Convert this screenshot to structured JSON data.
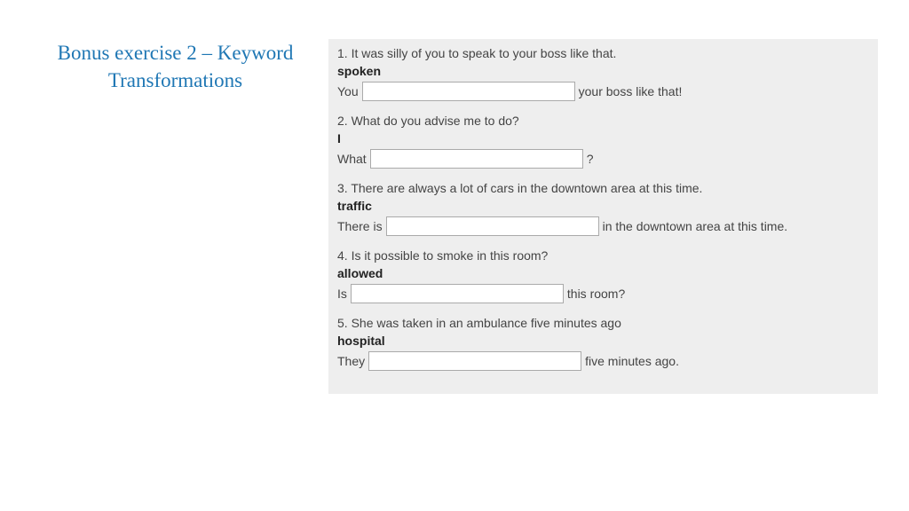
{
  "title": "Bonus exercise 2 – Keyword Transformations",
  "questions": [
    {
      "number": "1.",
      "prompt": "It was silly of you to speak to your boss like that.",
      "keyword": "spoken",
      "pre": "You",
      "post": "your boss like that!"
    },
    {
      "number": "2.",
      "prompt": "What do you advise me to do?",
      "keyword": "I",
      "pre": "What",
      "post": "?"
    },
    {
      "number": "3.",
      "prompt": "There are always a lot of cars in the downtown area at this time.",
      "keyword": "traffic",
      "pre": "There is",
      "post": "in the downtown area at this time."
    },
    {
      "number": "4.",
      "prompt": "Is it possible to smoke in this room?",
      "keyword": "allowed",
      "pre": "Is",
      "post": "this room?"
    },
    {
      "number": "5.",
      "prompt": "She was taken in an ambulance five minutes ago",
      "keyword": "hospital",
      "pre": "They",
      "post": "five minutes ago."
    }
  ]
}
